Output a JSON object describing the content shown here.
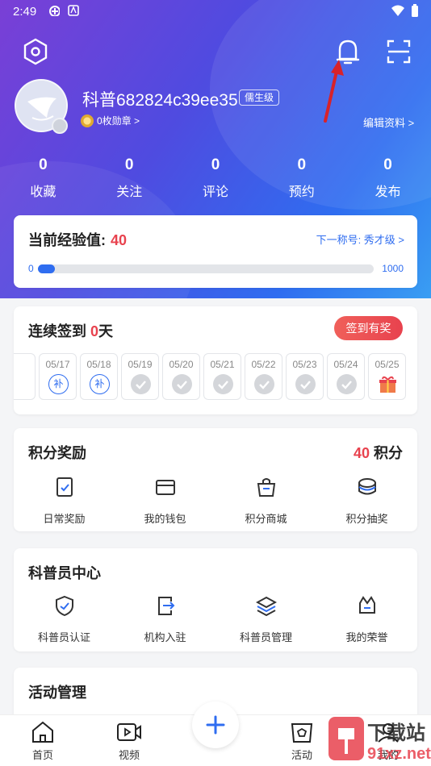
{
  "status_bar": {
    "time": "2:49"
  },
  "profile": {
    "username": "科普682824c39ee35",
    "level_badge": "儒生级",
    "medals": "0枚勋章 >",
    "edit_link": "编辑资料 >"
  },
  "stats": [
    {
      "value": "0",
      "label": "收藏"
    },
    {
      "value": "0",
      "label": "关注"
    },
    {
      "value": "0",
      "label": "评论"
    },
    {
      "value": "0",
      "label": "预约"
    },
    {
      "value": "0",
      "label": "发布"
    }
  ],
  "experience": {
    "title": "当前经验值:",
    "value": "40",
    "next_title": "下一称号: 秀才级 >",
    "min": "0",
    "max": "1000",
    "progress_fraction": 0.04
  },
  "signin": {
    "title_prefix": "连续签到 ",
    "days": "0",
    "title_suffix": "天",
    "button": "签到有奖",
    "calendar": [
      {
        "date": "05/17",
        "status": "补"
      },
      {
        "date": "05/18",
        "status": "补"
      },
      {
        "date": "05/19",
        "status": "done"
      },
      {
        "date": "05/20",
        "status": "done"
      },
      {
        "date": "05/21",
        "status": "done"
      },
      {
        "date": "05/22",
        "status": "done"
      },
      {
        "date": "05/23",
        "status": "done"
      },
      {
        "date": "05/24",
        "status": "done"
      },
      {
        "date": "05/25",
        "status": "gift"
      }
    ]
  },
  "points": {
    "title": "积分奖励",
    "value": "40",
    "unit": " 积分",
    "items": [
      {
        "label": "日常奖励",
        "icon": "task-icon"
      },
      {
        "label": "我的钱包",
        "icon": "wallet-icon"
      },
      {
        "label": "积分商城",
        "icon": "shop-icon"
      },
      {
        "label": "积分抽奖",
        "icon": "lottery-icon"
      }
    ]
  },
  "science_center": {
    "title": "科普员中心",
    "items": [
      {
        "label": "科普员认证",
        "icon": "shield-check-icon"
      },
      {
        "label": "机构入驻",
        "icon": "org-enter-icon"
      },
      {
        "label": "科普员管理",
        "icon": "layers-icon"
      },
      {
        "label": "我的荣誉",
        "icon": "honor-icon"
      }
    ]
  },
  "activity": {
    "title": "活动管理"
  },
  "tabbar": {
    "items": [
      {
        "label": "首页",
        "icon": "home-icon"
      },
      {
        "label": "视频",
        "icon": "video-icon"
      },
      {
        "label": "活动",
        "icon": "activity-icon"
      },
      {
        "label": "我的",
        "icon": "profile-icon"
      }
    ]
  },
  "watermark": {
    "text": "下载站",
    "url_text": "91xz.net"
  },
  "colors": {
    "accent": "#2f6df0",
    "highlight": "#e8424e"
  }
}
